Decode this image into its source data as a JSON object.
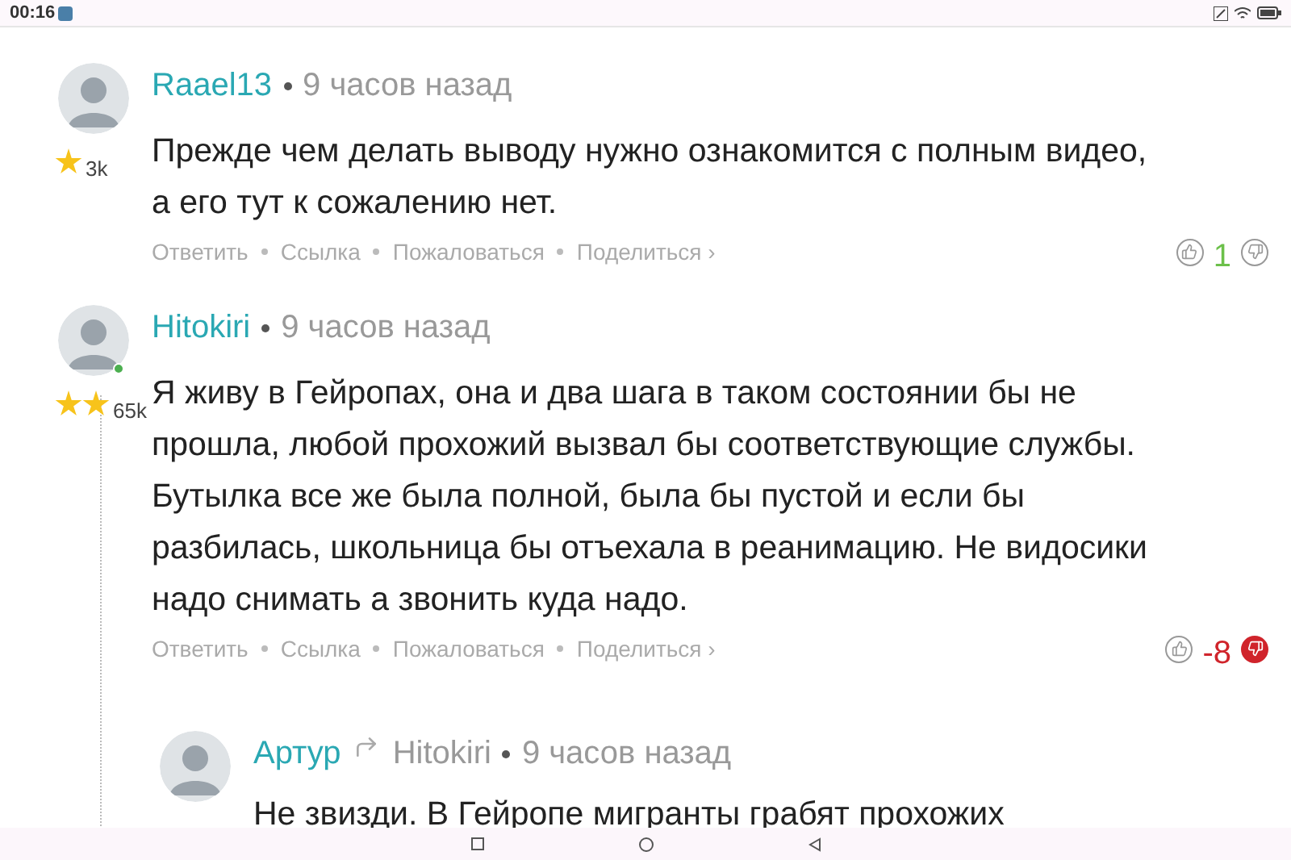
{
  "status_bar": {
    "time": "00:16"
  },
  "comments": [
    {
      "author": "Raael13",
      "time": "9 часов назад",
      "online": false,
      "badge": {
        "kind": "single"
      },
      "rating": "3k",
      "body": "Прежде чем делать выводу нужно ознакомится с полным видео, а его тут к сожалению нет.",
      "actions": [
        "Ответить",
        "Ссылка",
        "Пожаловаться",
        "Поделиться ›"
      ],
      "vote": {
        "score": "1",
        "color": "#6cc04a",
        "upvoted": false,
        "downvoted": false
      }
    },
    {
      "author": "Hitokiri",
      "time": "9 часов назад",
      "online": true,
      "badge": {
        "kind": "double"
      },
      "rating": "65k",
      "body": "Я живу в Гейропах, она и два шага в таком состоянии бы не прошла, любой прохожий вызвал бы соответствующие службы. Бутылка все же была полной, была бы пустой и если бы разбилась, школьница бы отъехала в реанимацию. Не видосики надо снимать а звонить куда надо.",
      "actions": [
        "Ответить",
        "Ссылка",
        "Пожаловаться",
        "Поделиться ›"
      ],
      "vote": {
        "score": "-8",
        "color": "#d0242b",
        "upvoted": false,
        "downvoted": true
      },
      "children": [
        {
          "author": "Артур",
          "reply_to": "Hitokiri",
          "time": "9 часов назад",
          "online": false,
          "body": "Не звизди. В Гейропе мигранты грабят прохожих"
        }
      ]
    }
  ]
}
